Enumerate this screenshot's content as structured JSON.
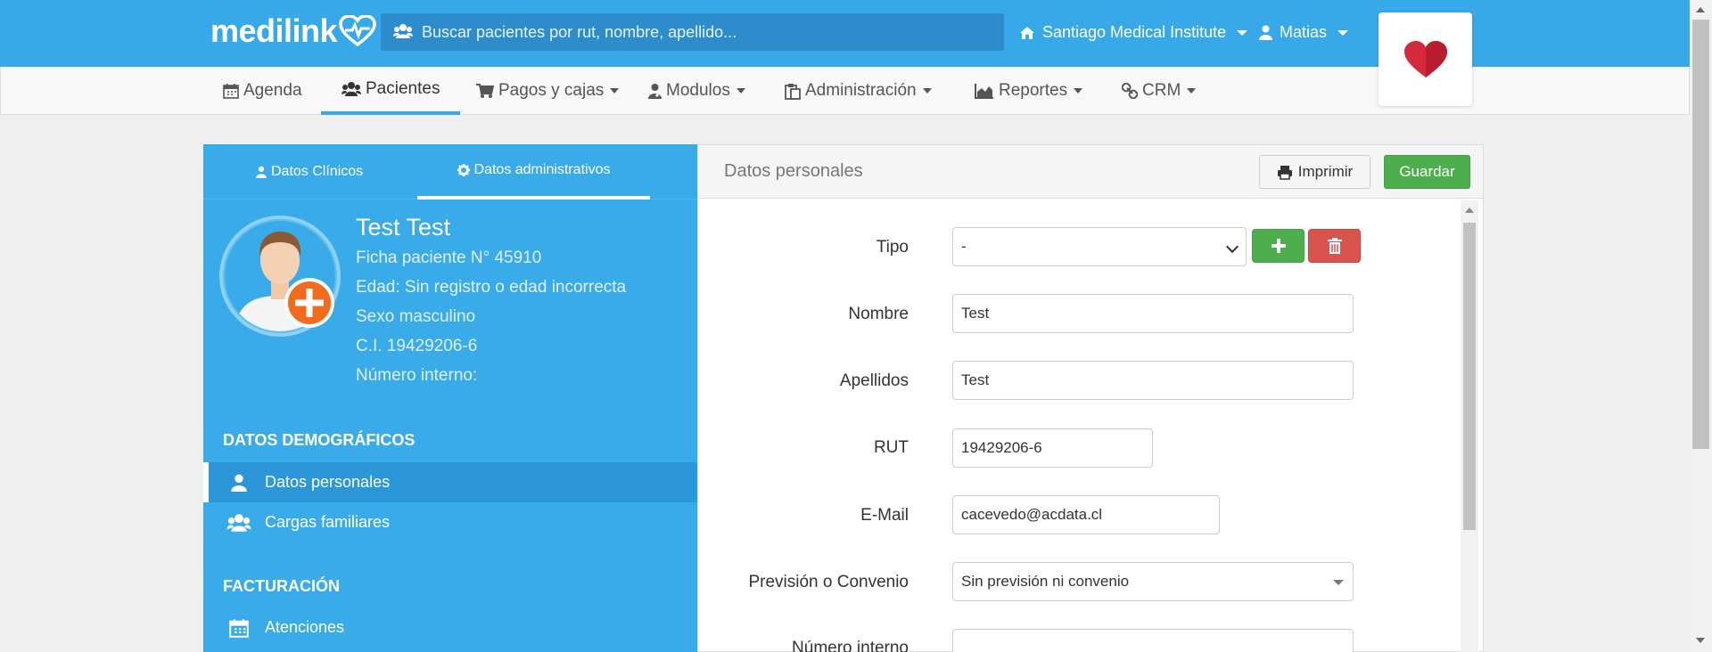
{
  "brand": {
    "logo_text": "medilink"
  },
  "search": {
    "placeholder": "Buscar pacientes por rut, nombre, apellido..."
  },
  "header": {
    "institution": "Santiago Medical Institute",
    "user": "Matias"
  },
  "nav": {
    "items": [
      {
        "label": "Agenda",
        "icon": "calendar-icon"
      },
      {
        "label": "Pacientes",
        "icon": "users-icon"
      },
      {
        "label": "Pagos y cajas",
        "icon": "cart-icon"
      },
      {
        "label": "Modulos",
        "icon": "doctor-icon"
      },
      {
        "label": "Administración",
        "icon": "clipboard-icon"
      },
      {
        "label": "Reportes",
        "icon": "area-chart-icon"
      },
      {
        "label": "CRM",
        "icon": "link-icon"
      }
    ],
    "active": "Pacientes"
  },
  "left": {
    "tabs": [
      {
        "label": "Datos Clínicos",
        "icon": "doctor-icon"
      },
      {
        "label": "Datos administrativos",
        "icon": "gear-icon"
      }
    ],
    "patient": {
      "name": "Test Test",
      "ficha": "Ficha paciente N° 45910",
      "edad": "Edad: Sin registro o edad incorrecta",
      "sexo": "Sexo masculino",
      "ci": "C.I. 19429206-6",
      "numero_interno": "Número interno:"
    },
    "sections": [
      {
        "title": "DATOS DEMOGRÁFICOS",
        "items": [
          {
            "label": "Datos personales",
            "icon": "user-icon",
            "active": true
          },
          {
            "label": "Cargas familiares",
            "icon": "users-icon",
            "active": false
          }
        ]
      },
      {
        "title": "FACTURACIÓN",
        "items": [
          {
            "label": "Atenciones",
            "icon": "calendar-icon",
            "active": false
          }
        ]
      }
    ]
  },
  "right": {
    "title": "Datos personales",
    "print_label": "Imprimir",
    "save_label": "Guardar",
    "form": {
      "tipo": {
        "label": "Tipo",
        "value": "-"
      },
      "nombre": {
        "label": "Nombre",
        "value": "Test"
      },
      "apellidos": {
        "label": "Apellidos",
        "value": "Test"
      },
      "rut": {
        "label": "RUT",
        "value": "19429206-6"
      },
      "email": {
        "label": "E-Mail",
        "value": "cacevedo@acdata.cl"
      },
      "prevision": {
        "label": "Previsión o Convenio",
        "value": "Sin previsión ni convenio"
      },
      "numero_interno": {
        "label": "Número interno",
        "value": ""
      }
    }
  },
  "colors": {
    "primary": "#38a9e8",
    "success": "#4cae4c",
    "danger": "#d9534f"
  }
}
